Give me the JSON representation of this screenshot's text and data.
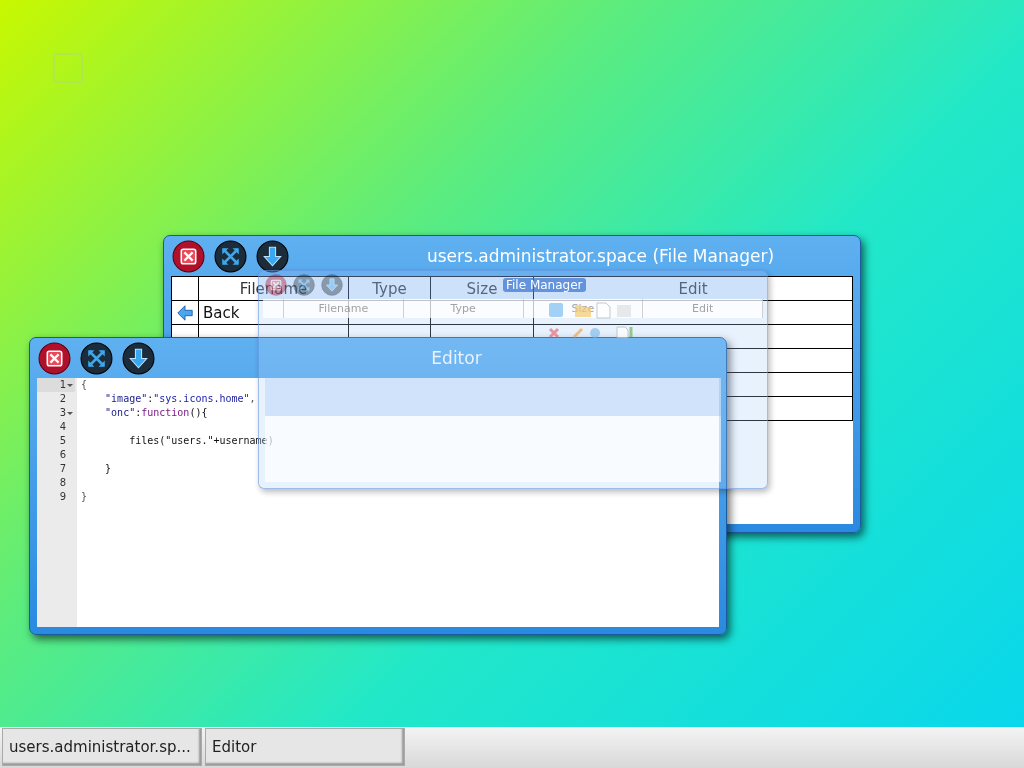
{
  "windows": [
    {
      "kind": "file_manager",
      "title": "users.administrator.space (File Manager)",
      "table": {
        "columns": [
          "Filename",
          "Type",
          "Size",
          "Edit"
        ],
        "rows": [
          {
            "kind": "back",
            "filename": "Back"
          }
        ]
      }
    },
    {
      "kind": "editor",
      "title": "Editor",
      "lines": [
        {
          "number": "1",
          "foldable": true,
          "current": true,
          "tokens": [
            {
              "kind": "punct",
              "text": "{"
            }
          ]
        },
        {
          "number": "2",
          "foldable": false,
          "current": false,
          "tokens": [
            {
              "kind": "key",
              "text": "    \"image\""
            },
            {
              "kind": "plain",
              "text": ":"
            },
            {
              "kind": "string",
              "text": "\"sys.icons.home\""
            },
            {
              "kind": "punct",
              "text": ","
            }
          ]
        },
        {
          "number": "3",
          "foldable": true,
          "current": false,
          "tokens": [
            {
              "kind": "key",
              "text": "    \"onc\""
            },
            {
              "kind": "plain",
              "text": ":"
            },
            {
              "kind": "keyword",
              "text": "function"
            },
            {
              "kind": "plain",
              "text": "(){"
            }
          ]
        },
        {
          "number": "4",
          "foldable": false,
          "current": false
        },
        {
          "number": "5",
          "foldable": false,
          "current": false,
          "tokens": [
            {
              "kind": "plain",
              "text": "        files(\"users.\"+username)"
            }
          ]
        },
        {
          "number": "6",
          "foldable": false,
          "current": false
        },
        {
          "number": "7",
          "foldable": false,
          "current": false,
          "tokens": [
            {
              "kind": "plain",
              "text": "    }"
            }
          ]
        },
        {
          "number": "8",
          "foldable": false,
          "current": false
        },
        {
          "number": "9",
          "foldable": false,
          "current": false,
          "tokens": [
            {
              "kind": "punct",
              "text": "}"
            }
          ]
        }
      ]
    }
  ],
  "preview": {
    "title": "File Manager",
    "columns": [
      "Filename",
      "Type",
      "Size",
      "Edit"
    ]
  },
  "taskbar": {
    "items": [
      {
        "label": "users.administrator.sp..."
      },
      {
        "label": "Editor"
      }
    ]
  }
}
